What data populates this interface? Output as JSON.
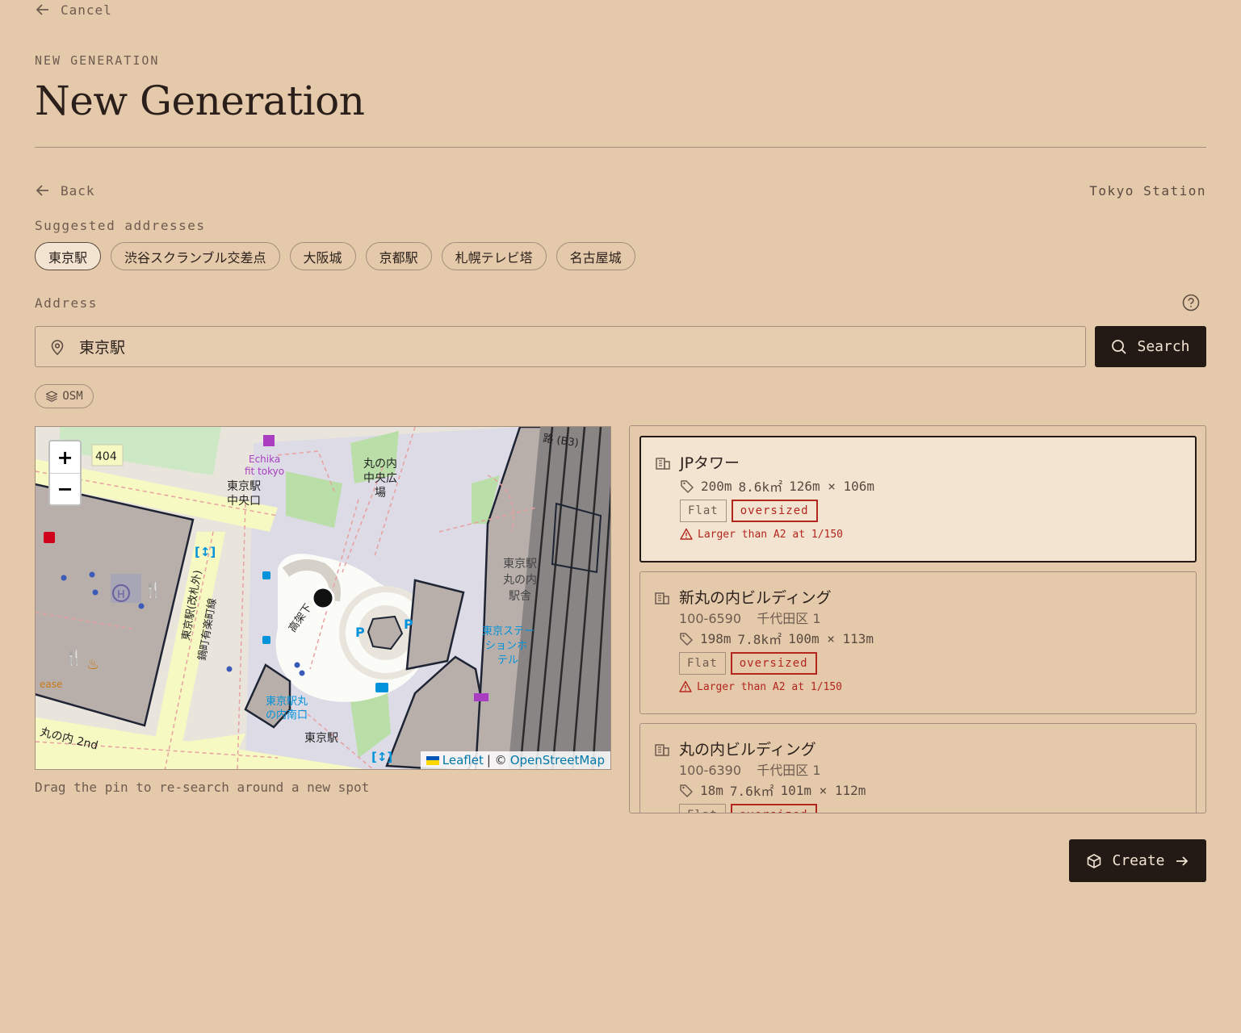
{
  "nav": {
    "cancel_label": "Cancel",
    "back_label": "Back"
  },
  "header": {
    "eyebrow": "NEW GENERATION",
    "title": "New Generation"
  },
  "location_name": "Tokyo Station",
  "suggestions": {
    "label": "Suggested addresses",
    "items": [
      "東京駅",
      "渋谷スクランブル交差点",
      "大阪城",
      "京都駅",
      "札幌テレビ塔",
      "名古屋城"
    ],
    "selected": "東京駅"
  },
  "address": {
    "label": "Address",
    "value": "東京駅",
    "search_label": "Search",
    "source_badge": "OSM"
  },
  "map": {
    "zoom_in": "+",
    "zoom_out": "−",
    "attribution_leaflet": "Leaflet",
    "attribution_sep": "| ©",
    "attribution_osm": "OpenStreetMap",
    "hint": "Drag the pin to re-search around a new spot",
    "labels": {
      "road_404": "404",
      "echika": "Echika",
      "fit_tokyo": "fit tokyo",
      "tokyo_central_exit_1": "東京駅",
      "tokyo_central_exit_2": "中央口",
      "marunouchi_plaza_1": "丸の内",
      "marunouchi_plaza_2": "中央広",
      "marunouchi_plaza_3": "場",
      "station_building_1": "東京駅",
      "station_building_2": "丸の内",
      "station_building_3": "駅舎",
      "station_hotel_1": "東京ステー",
      "station_hotel_2": "ションホ",
      "station_hotel_3": "テル",
      "south_exit_1": "東京駅丸",
      "south_exit_2": "の内南口",
      "tokyo_st_bottom": "東京駅",
      "marunouchi_2nd": "丸の内 2nd",
      "ease": "ease",
      "yurakucho_line": "鍋町有楽町線",
      "gaito": "高架下",
      "tokyo_kaisatsu": "東京駅(改札外)",
      "b3": "路 (B3)"
    }
  },
  "results": [
    {
      "name": "JPタワー",
      "address_code": "",
      "address_ward": "",
      "height": "200m",
      "area": "8.6k㎡",
      "dims": "126m × 106m",
      "tags": [
        "Flat",
        "oversized"
      ],
      "warning": "Larger than A2 at 1/150"
    },
    {
      "name": "新丸の内ビルディング",
      "address_code": "100-6590",
      "address_ward": "千代田区 1",
      "height": "198m",
      "area": "7.8k㎡",
      "dims": "100m × 113m",
      "tags": [
        "Flat",
        "oversized"
      ],
      "warning": "Larger than A2 at 1/150"
    },
    {
      "name": "丸の内ビルディング",
      "address_code": "100-6390",
      "address_ward": "千代田区 1",
      "height": "18m",
      "area": "7.6k㎡",
      "dims": "101m × 112m",
      "tags": [
        "Flat",
        "oversized"
      ],
      "warning": ""
    }
  ],
  "create_label": "Create",
  "colors": {
    "background": "#e4c9aa",
    "dark_button": "#231a16",
    "selected_card": "#f3e4d2",
    "warning_red": "#b3261e",
    "border": "#a5907e"
  }
}
